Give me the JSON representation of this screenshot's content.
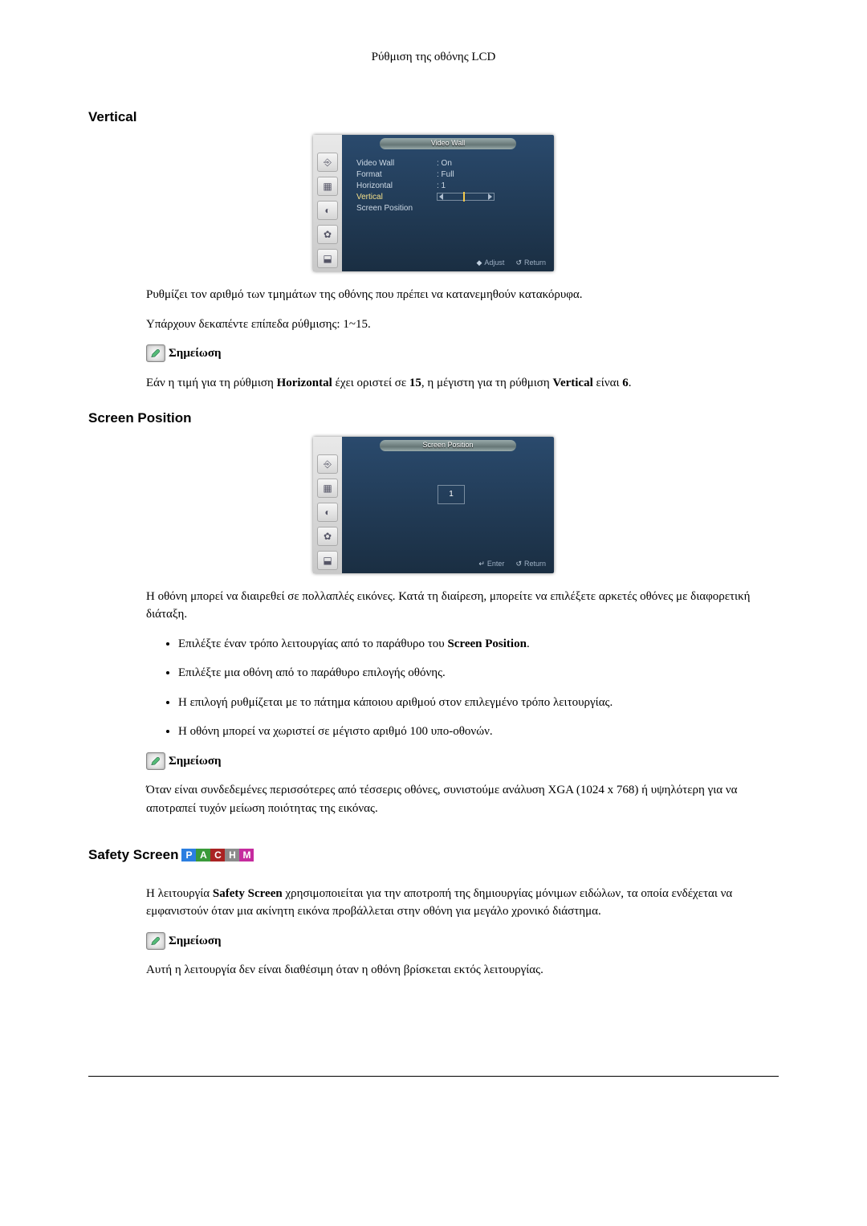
{
  "pageHeader": "Ρύθμιση της οθόνης LCD",
  "vertical": {
    "heading": "Vertical",
    "osd": {
      "title": "Video Wall",
      "rows": {
        "r0": {
          "label": "Video Wall",
          "value": ": On"
        },
        "r1": {
          "label": "Format",
          "value": ": Full"
        },
        "r2": {
          "label": "Horizontal",
          "value": ": 1"
        },
        "r3": {
          "label": "Vertical",
          "value": ""
        },
        "r4": {
          "label": "Screen Position",
          "value": ""
        }
      },
      "footer": {
        "adjust": "Adjust",
        "return": "Return"
      }
    },
    "para1": "Ρυθμίζει τον αριθμό των τμημάτων της οθόνης που πρέπει να κατανεμηθούν κατακόρυφα.",
    "para2": "Υπάρχουν δεκαπέντε επίπεδα ρύθμισης: 1~15.",
    "noteLabel": "Σημείωση",
    "noteText_a": "Εάν η τιμή για τη ρύθμιση ",
    "noteText_b": "Horizontal",
    "noteText_c": " έχει οριστεί σε ",
    "noteText_d": "15",
    "noteText_e": ", η μέγιστη για τη ρύθμιση ",
    "noteText_f": "Vertical",
    "noteText_g": " είναι ",
    "noteText_h": "6",
    "noteText_i": "."
  },
  "screenPosition": {
    "heading": "Screen Position",
    "osd": {
      "title": "Screen Position",
      "cell": "1",
      "footer": {
        "enter": "Enter",
        "return": "Return"
      }
    },
    "para1": "Η οθόνη μπορεί να διαιρεθεί σε πολλαπλές εικόνες. Κατά τη διαίρεση, μπορείτε να επιλέξετε αρκετές οθόνες με διαφορετική διάταξη.",
    "bullets": {
      "b0_a": "Επιλέξτε έναν τρόπο λειτουργίας από το παράθυρο του ",
      "b0_b": "Screen Position",
      "b0_c": ".",
      "b1": "Επιλέξτε μια οθόνη από το παράθυρο επιλογής οθόνης.",
      "b2": "Η επιλογή ρυθμίζεται με το πάτημα κάποιου αριθμού στον επιλεγμένο τρόπο λειτουργίας.",
      "b3": "Η οθόνη μπορεί να χωριστεί σε μέγιστο αριθμό 100 υπο-οθονών."
    },
    "noteLabel": "Σημείωση",
    "noteText": "Όταν είναι συνδεδεμένες περισσότερες από τέσσερις οθόνες, συνιστούμε ανάλυση XGA (1024 x 768) ή υψηλότερη για να αποτραπεί τυχόν μείωση ποιότητας της εικόνας."
  },
  "safetyScreen": {
    "heading": "Safety Screen",
    "chips": {
      "p": "P",
      "a": "A",
      "c": "C",
      "h": "H",
      "m": "M"
    },
    "para_a": "Η λειτουργία ",
    "para_b": "Safety Screen",
    "para_c": " χρησιμοποιείται για την αποτροπή της δημιουργίας μόνιμων ειδώλων, τα οποία ενδέχεται να εμφανιστούν όταν μια ακίνητη εικόνα προβάλλεται στην οθόνη για μεγάλο χρονικό διάστημα.",
    "noteLabel": "Σημείωση",
    "noteText": "Αυτή η λειτουργία δεν είναι διαθέσιμη όταν η οθόνη βρίσκεται εκτός λειτουργίας."
  }
}
